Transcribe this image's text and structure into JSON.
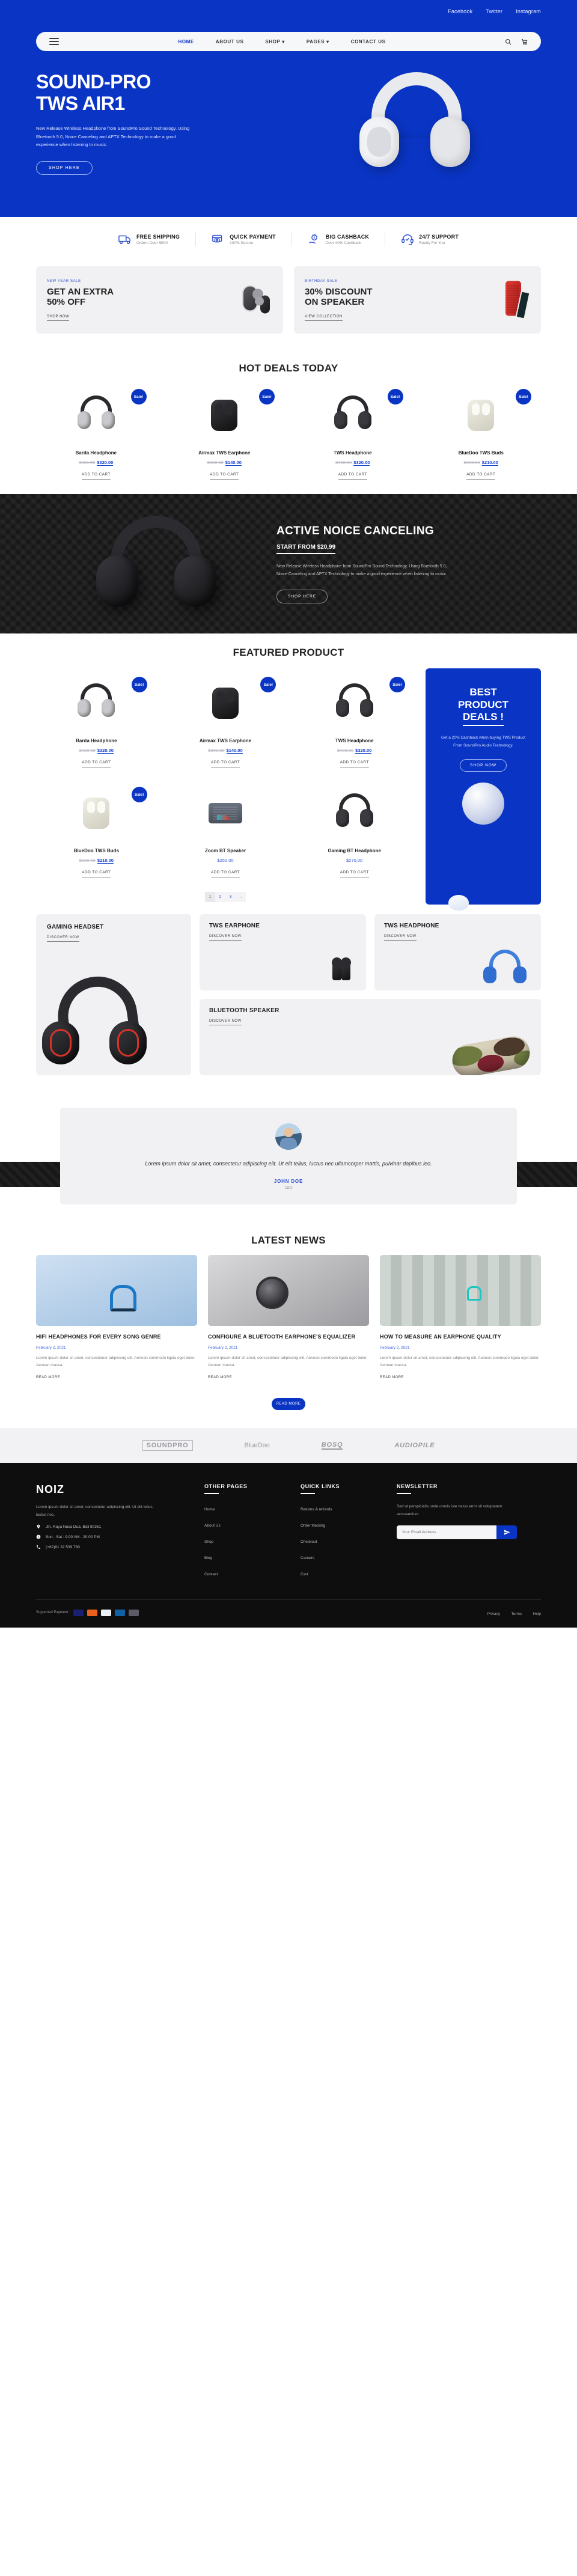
{
  "brand": {
    "name": "NOIZ",
    "accent": "#0a35c4"
  },
  "topbar": {
    "links": [
      "Facebook",
      "Twitter",
      "Instagram"
    ]
  },
  "nav": {
    "items": [
      {
        "label": "HOME",
        "active": true
      },
      {
        "label": "ABOUT US",
        "active": false
      },
      {
        "label": "SHOP",
        "active": false,
        "caret": true
      },
      {
        "label": "PAGES",
        "active": false,
        "caret": true
      },
      {
        "label": "CONTACT US",
        "active": false
      }
    ],
    "search_icon": "search-icon",
    "cart_icon": "cart-icon",
    "menu_icon": "hamburger-icon"
  },
  "hero": {
    "title_line1": "SOUND-PRO",
    "title_line2": "TWS AIR1",
    "description": "New Release Wireless Headphone from SoundPro Sound Technology. Using Bluetooth 5.0, Noice Canceling and APTX Technology to make a good experience when listening to music.",
    "cta": "SHOP HERE"
  },
  "features": [
    {
      "icon": "truck-icon",
      "title": "FREE SHIPPING",
      "sub": "Orders Over $500"
    },
    {
      "icon": "credit-card-icon",
      "title": "QUICK PAYMENT",
      "sub": "100% Secure"
    },
    {
      "icon": "cashback-icon",
      "title": "BIG CASHBACK",
      "sub": "Over 40% Cashback"
    },
    {
      "icon": "headset-support-icon",
      "title": "24/7 SUPPORT",
      "sub": "Ready For You"
    }
  ],
  "promos": [
    {
      "tag": "NEW YEAR SALE",
      "title_line1": "GET AN EXTRA",
      "title_line2": "50% OFF",
      "cta": "SHOP NOW",
      "art": "earbuds"
    },
    {
      "tag": "BIRTHDAY SALE",
      "title_line1": "30% DISCOUNT",
      "title_line2": "ON SPEAKER",
      "cta": "VIEW COLLECTION",
      "art": "speaker"
    }
  ],
  "hot_deals": {
    "title": "HOT DEALS TODAY",
    "add_to_cart": "ADD TO CART",
    "sale_badge": "Sale!",
    "products": [
      {
        "name": "Barda Headphone",
        "old_price": "$420.00",
        "price": "$320.00",
        "sale": true,
        "art": "over-ear-silver"
      },
      {
        "name": "Airmax TWS Earphone",
        "old_price": "$300.00",
        "price": "$140.00",
        "sale": true,
        "art": "case-black"
      },
      {
        "name": "TWS Headphone",
        "old_price": "$400.00",
        "price": "$320.00",
        "sale": true,
        "art": "over-ear-black"
      },
      {
        "name": "BlueDoo TWS Buds",
        "old_price": "$300.00",
        "price": "$210.00",
        "sale": true,
        "art": "case-cream"
      }
    ]
  },
  "noise_banner": {
    "title": "ACTIVE NOICE CANCELING",
    "start_from": "START FROM $20,99",
    "description": "New Release Wireless Headphone from SoundPro Sound Technology. Using Bluetooth 5.0, Noice Canceling and APTX Technology to make a good experience when listening to music.",
    "cta": "SHOP HERE"
  },
  "featured": {
    "title": "FEATURED PRODUCT",
    "add_to_cart": "ADD TO CART",
    "sale_badge": "Sale!",
    "products": [
      {
        "name": "Barda Headphone",
        "old_price": "$420.00",
        "price": "$320.00",
        "sale": true,
        "art": "over-ear-silver"
      },
      {
        "name": "Airmax TWS Earphone",
        "old_price": "$300.00",
        "price": "$140.00",
        "sale": true,
        "art": "case-black"
      },
      {
        "name": "TWS Headphone",
        "old_price": "$400.00",
        "price": "$320.00",
        "sale": true,
        "art": "over-ear-black"
      },
      {
        "name": "BlueDoo TWS Buds",
        "old_price": "$300.00",
        "price": "$210.00",
        "sale": true,
        "art": "case-cream"
      },
      {
        "name": "Zoom BT Speaker",
        "old_price": "",
        "price": "$250.00",
        "sale": false,
        "art": "speaker-grey"
      },
      {
        "name": "Gaming BT Headphone",
        "old_price": "",
        "price": "$270.00",
        "sale": false,
        "art": "over-ear-black"
      }
    ],
    "pagination": {
      "pages": [
        "1",
        "2",
        "3"
      ],
      "current": "1",
      "next_icon": "arrow-right-icon"
    },
    "promo_card": {
      "title_line1": "BEST",
      "title_line2": "PRODUCT",
      "title_line3": "DEALS !",
      "description": "Get a 20% Cashback when buying TWS Product From SoundPro Audio Technology.",
      "cta": "SHOP NOW"
    }
  },
  "categories": {
    "discover": "DISCOVER NOW",
    "items": [
      {
        "title": "GAMING HEADSET",
        "art": "gaming-headset"
      },
      {
        "title": "TWS EARPHONE",
        "art": "earbuds-black"
      },
      {
        "title": "TWS HEADPHONE",
        "art": "headphone-blue"
      },
      {
        "title": "BLUETOOTH SPEAKER",
        "art": "camo-speaker"
      }
    ]
  },
  "testimonial": {
    "quote": "Lorem ipsum dolor sit amet, consectetur adipiscing elit. Ut elit tellus, luctus nec ullamcorper mattis, pulvinar dapibus leo.",
    "author": "JOHN DOE",
    "role": "CEO"
  },
  "news": {
    "title": "LATEST NEWS",
    "read_more": "READ MORE",
    "load_more": "READ MORE",
    "posts": [
      {
        "title": "HIFI HEADPHONES FOR EVERY SONG GENRE",
        "date": "February 2, 2021",
        "excerpt": "Lorem ipsum dolor sit amet, consectetuer adipiscing elit. Aenean commodo ligula eget dolor. Aenean massa."
      },
      {
        "title": "CONFIGURE A BLUETOOTH EARPHONE'S EQUALIZER",
        "date": "February 2, 2021",
        "excerpt": "Lorem ipsum dolor sit amet, consectetuer adipiscing elit. Aenean commodo ligula eget dolor. Aenean massa."
      },
      {
        "title": "HOW TO MEASURE AN EARPHONE QUALITY",
        "date": "February 2, 2021",
        "excerpt": "Lorem ipsum dolor sit amet, consectetuer adipiscing elit. Aenean commodo ligula eget dolor. Aenean massa."
      }
    ]
  },
  "brands": [
    "SOUNDPRO",
    "BlueDeo",
    "BOSQ",
    "AUDIOPILE"
  ],
  "footer": {
    "brand": "NOIZ",
    "description": "Lorem ipsum dolor sit amet, consectetur adipiscing elit. Ut elit tellus, luctus nec.",
    "address": "Jln. Raya Nusa Dua, Bali 80361",
    "hours": "Sun - Sat : 9:00 AM - 20:00 PM",
    "phone": "(+62)81 32 539 780",
    "other_pages": {
      "heading": "OTHER PAGES",
      "links": [
        "Home",
        "About Us",
        "Shop",
        "Blog",
        "Contact"
      ]
    },
    "quick_links": {
      "heading": "QUICK LINKS",
      "links": [
        "Returns & refunds",
        "Order tracking",
        "Checkout",
        "Careers",
        "Cart"
      ]
    },
    "newsletter": {
      "heading": "NEWSLETTER",
      "description": "Sed ut perspiciatis unde omnis iste natus error sit voluptatem accusantium",
      "placeholder": "Your Email Address",
      "value": "",
      "submit_icon": "send-icon"
    },
    "payment_label": "Supported Payment :",
    "bottom_links": [
      "Privacy",
      "Terms",
      "Help"
    ]
  }
}
